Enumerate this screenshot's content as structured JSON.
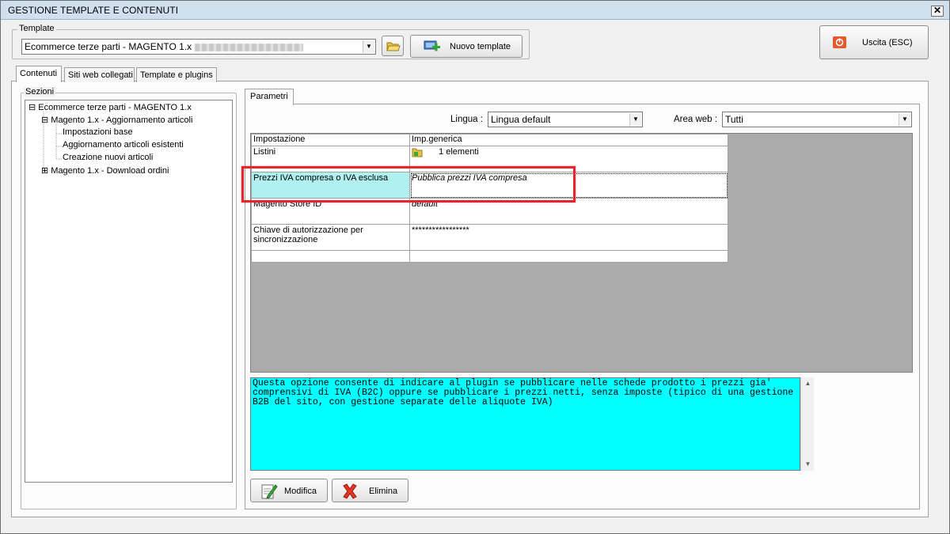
{
  "window": {
    "title": "GESTIONE TEMPLATE E CONTENUTI",
    "close_label": "✕"
  },
  "template_group": {
    "legend": "Template",
    "selected": "Ecommerce terze parti - MAGENTO 1.x",
    "new_template_label": "Nuovo template"
  },
  "exit_button": {
    "label": "Uscita (ESC)"
  },
  "main_tabs": [
    {
      "label": "Contenuti"
    },
    {
      "label": "Siti web collegati"
    },
    {
      "label": "Template e plugins"
    }
  ],
  "sections": {
    "legend": "Sezioni",
    "tree": [
      {
        "label": "Ecommerce terze parti - MAGENTO 1.x",
        "expander": "⊟"
      },
      {
        "label": "Magento 1.x - Aggiornamento articoli",
        "expander": "⊟"
      },
      {
        "label": "Impostazioni base",
        "expander": ""
      },
      {
        "label": "Aggiornamento articoli esistenti",
        "expander": ""
      },
      {
        "label": "Creazione nuovi articoli",
        "expander": ""
      },
      {
        "label": "Magento 1.x - Download ordini",
        "expander": "⊞"
      }
    ]
  },
  "params_tab": {
    "label": "Parametri"
  },
  "filters": {
    "language_label": "Lingua :",
    "language_value": "Lingua default",
    "area_label": "Area web :",
    "area_value": "Tutti"
  },
  "grid": {
    "headers": [
      "Impostazione",
      "Imp.generica"
    ],
    "rows": [
      {
        "setting": "Listini",
        "value": "1 elementi"
      },
      {
        "setting": "Prezzi IVA compresa o IVA esclusa",
        "value": "Pubblica prezzi IVA compresa"
      },
      {
        "setting": "Magento Store ID",
        "value": "default"
      },
      {
        "setting": "Chiave di autorizzazione per sincronizzazione",
        "value": "*****************"
      },
      {
        "setting": "",
        "value": ""
      }
    ]
  },
  "help_text": "Questa opzione consente di indicare al plugin se pubblicare nelle schede prodotto i prezzi gia' comprensivi di IVA (B2C) oppure se pubblicare i prezzi netti, senza imposte (tipico di una gestione B2B del sito, con gestione separate delle aliquote IVA)",
  "actions": {
    "edit_label": "Modifica",
    "delete_label": "Elimina"
  },
  "colors": {
    "help_bg": "#00ffff",
    "selected_cell": "#b0f0f0",
    "highlight": "#e8252b",
    "grid_bg": "#ababab"
  }
}
